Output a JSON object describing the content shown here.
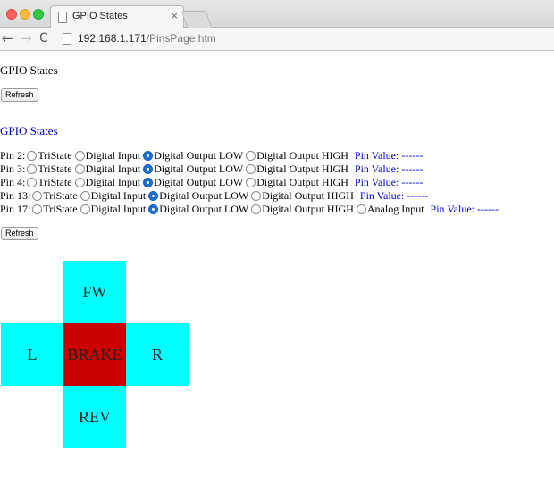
{
  "browser": {
    "tab_title": "GPIO States",
    "tab_close": "×",
    "url_host": "192.168.1.171",
    "url_path": "/PinsPage.htm",
    "back": "←",
    "forward": "→",
    "reload": "C"
  },
  "page": {
    "heading": "GPIO States",
    "refresh_top": "Refresh",
    "section_heading": "GPIO States",
    "refresh_bottom": "Refresh",
    "pins": [
      {
        "label": "Pin 2:",
        "options": [
          "TriState",
          "Digital Input",
          "Digital Output LOW",
          "Digital Output HIGH"
        ],
        "selected": 2,
        "value": "Pin Value: ------"
      },
      {
        "label": "Pin 3:",
        "options": [
          "TriState",
          "Digital Input",
          "Digital Output LOW",
          "Digital Output HIGH"
        ],
        "selected": 2,
        "value": "Pin Value: ------"
      },
      {
        "label": "Pin 4:",
        "options": [
          "TriState",
          "Digital Input",
          "Digital Output LOW",
          "Digital Output HIGH"
        ],
        "selected": 2,
        "value": "Pin Value: ------"
      },
      {
        "label": "Pin 13:",
        "options": [
          "TriState",
          "Digital Input",
          "Digital Output LOW",
          "Digital Output HIGH"
        ],
        "selected": 2,
        "value": "Pin Value: ------"
      },
      {
        "label": "Pin 17:",
        "options": [
          "TriState",
          "Digital Input",
          "Digital Output LOW",
          "Digital Output HIGH",
          "Analog Input"
        ],
        "selected": 2,
        "value": "Pin Value: ------"
      }
    ],
    "controls": {
      "forward": "FW",
      "left": "L",
      "brake": "BRAKE",
      "right": "R",
      "reverse": "REV"
    }
  },
  "colors": {
    "link_blue": "#0000cc",
    "pad_cyan": "#00ffff",
    "brake_red": "#cc0000"
  }
}
